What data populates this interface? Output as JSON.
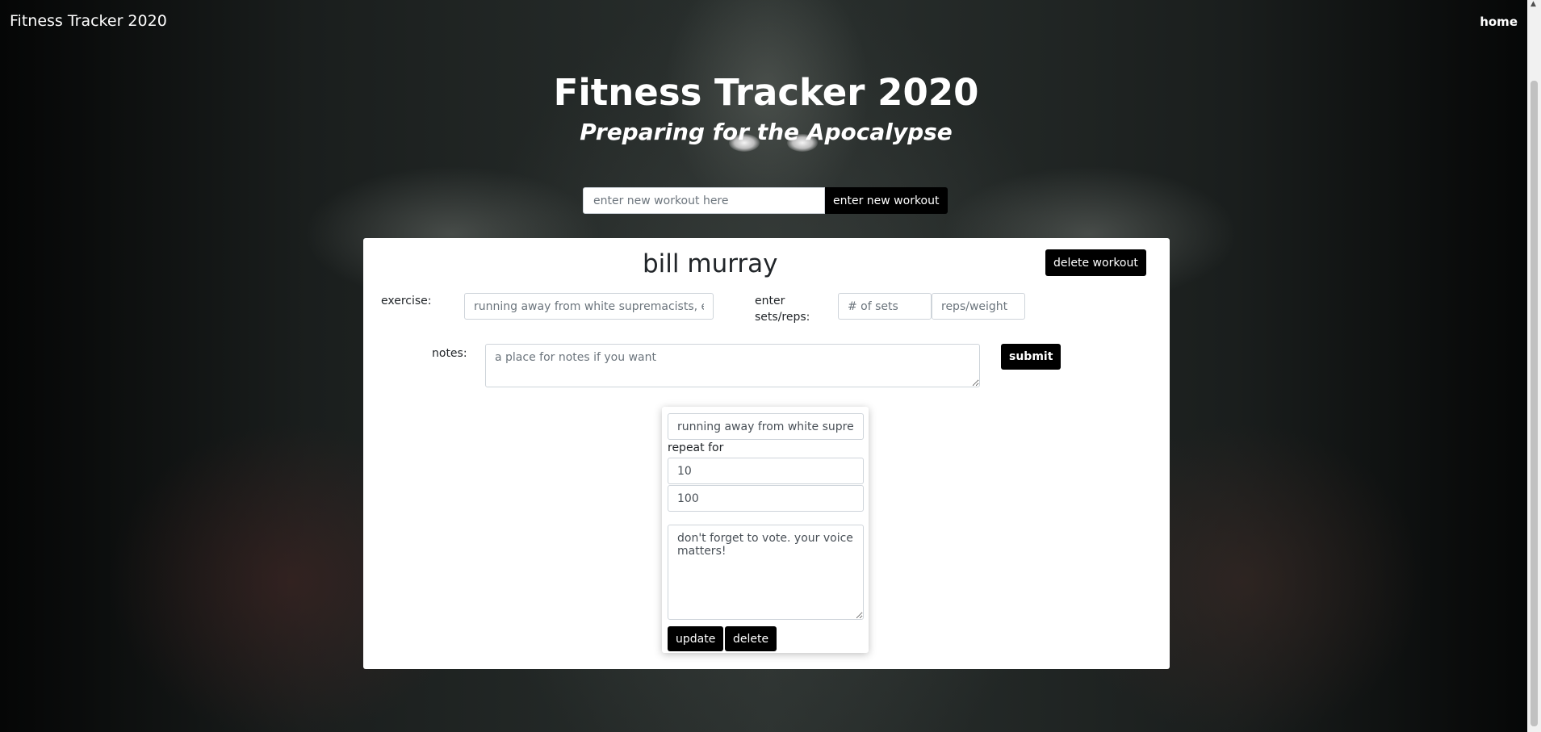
{
  "navbar": {
    "brand": "Fitness Tracker 2020",
    "home_link": "home"
  },
  "hero": {
    "title": "Fitness Tracker 2020",
    "subtitle": "Preparing for the Apocalypse"
  },
  "new_workout": {
    "placeholder": "enter new workout here",
    "button_label": "enter new workout"
  },
  "workout": {
    "name": "bill murray",
    "delete_label": "delete workout",
    "exercise_label": "exercise:",
    "exercise_placeholder": "running away from white supremacists, etc.",
    "sets_reps_label": "enter sets/reps:",
    "sets_placeholder": "# of sets",
    "reps_placeholder": "reps/weight",
    "notes_label": "notes:",
    "notes_placeholder": "a place for notes if you want",
    "submit_label": "submit"
  },
  "entry": {
    "exercise_value": "running away from white supremacists, etc.",
    "repeat_label": "repeat for",
    "sets_value": "10",
    "reps_value": "100",
    "notes_value": "don't forget to vote. your voice matters!",
    "update_label": "update",
    "delete_label": "delete"
  },
  "colors": {
    "button_bg": "#000000",
    "card_bg": "#ffffff",
    "hero_text": "#ffffff"
  }
}
